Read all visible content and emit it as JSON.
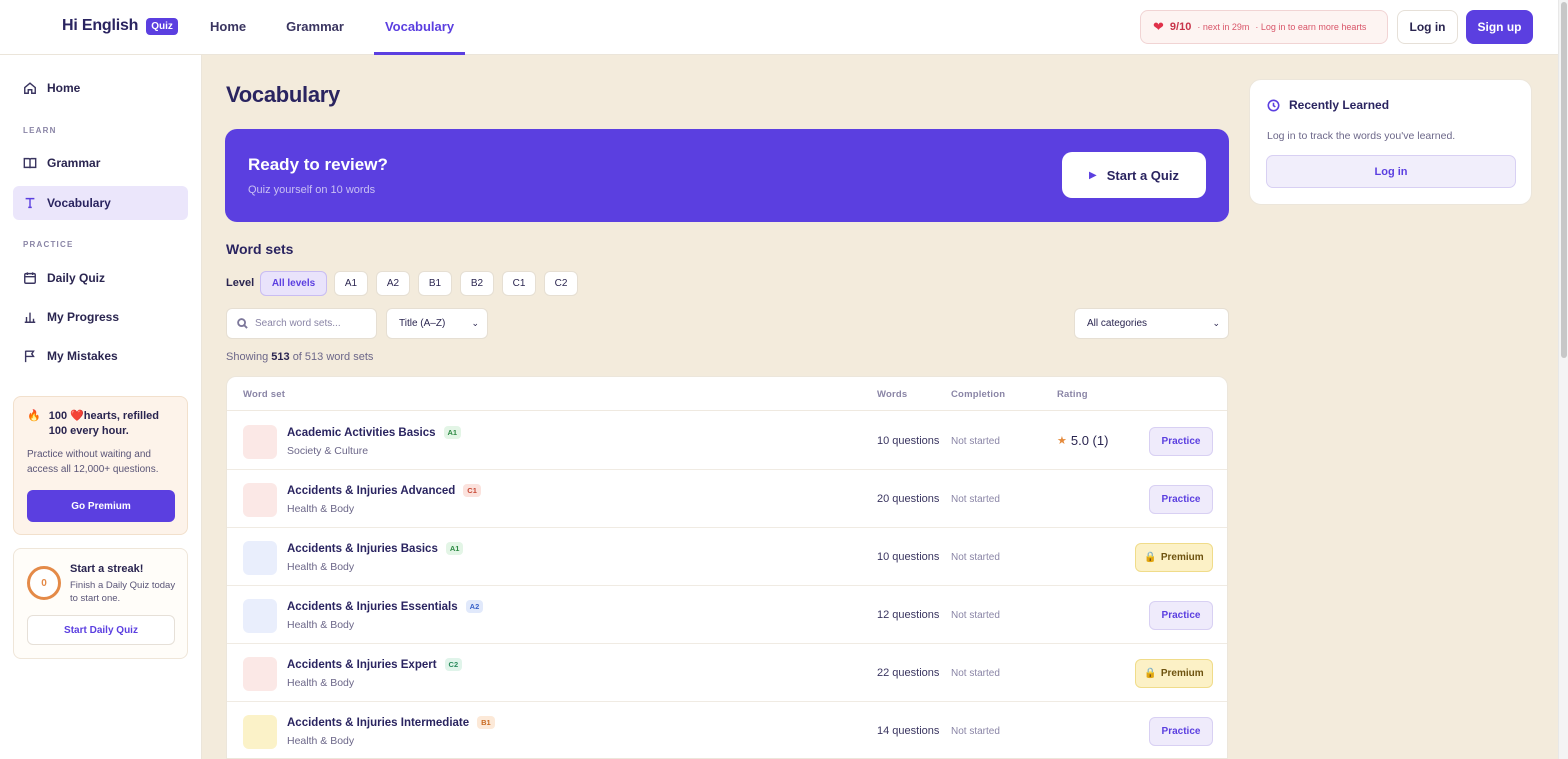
{
  "brand": {
    "name": "Hi English",
    "badge": "Quiz"
  },
  "topnav": [
    "Home",
    "Grammar",
    "Vocabulary"
  ],
  "hearts": {
    "count": "9/10",
    "next": "· next in 29m",
    "login_note": "· Log in to earn more hearts"
  },
  "auth": {
    "login": "Log in",
    "signup": "Sign up"
  },
  "sidebar": {
    "home": "Home",
    "learn_label": "LEARN",
    "grammar": "Grammar",
    "vocabulary": "Vocabulary",
    "practice_label": "PRACTICE",
    "daily_quiz": "Daily Quiz",
    "my_progress": "My Progress",
    "my_mistakes": "My Mistakes",
    "promo": {
      "title": "100 ❤️hearts, refilled 100 every hour.",
      "desc": "Practice without waiting and access all 12,000+ questions.",
      "button": "Go Premium"
    },
    "streak": {
      "count": "0",
      "title": "Start a streak!",
      "desc": "Finish a Daily Quiz today to start one.",
      "button": "Start Daily Quiz"
    }
  },
  "main": {
    "title": "Vocabulary",
    "hero": {
      "title": "Ready to review?",
      "subtitle": "Quiz yourself on 10 words",
      "button": "Start a Quiz"
    },
    "word_sets_title": "Word sets",
    "level_label": "Level",
    "levels": [
      "All levels",
      "A1",
      "A2",
      "B1",
      "B2",
      "C1",
      "C2"
    ],
    "search_placeholder": "Search word sets...",
    "sort": "Title (A–Z)",
    "category": "All categories",
    "showing": {
      "prefix": "Showing",
      "count": "513",
      "suffix": "of 513 word sets"
    },
    "table": {
      "headers": [
        "Word set",
        "Words",
        "Completion",
        "Rating"
      ],
      "rows": [
        {
          "name": "Academic Activities Basics",
          "level": "A1",
          "category": "Society & Culture",
          "words": "10 questions",
          "completion": "Not started",
          "rating": "5.0 (1)",
          "action": "Practice"
        },
        {
          "name": "Accidents & Injuries Advanced",
          "level": "C1",
          "category": "Health & Body",
          "words": "20 questions",
          "completion": "Not started",
          "rating": "",
          "action": "Practice"
        },
        {
          "name": "Accidents & Injuries Basics",
          "level": "A1",
          "category": "Health & Body",
          "words": "10 questions",
          "completion": "Not started",
          "rating": "",
          "action": "Premium"
        },
        {
          "name": "Accidents & Injuries Essentials",
          "level": "A2",
          "category": "Health & Body",
          "words": "12 questions",
          "completion": "Not started",
          "rating": "",
          "action": "Practice"
        },
        {
          "name": "Accidents & Injuries Expert",
          "level": "C2",
          "category": "Health & Body",
          "words": "22 questions",
          "completion": "Not started",
          "rating": "",
          "action": "Premium"
        },
        {
          "name": "Accidents & Injuries Intermediate",
          "level": "B1",
          "category": "Health & Body",
          "words": "14 questions",
          "completion": "Not started",
          "rating": "",
          "action": "Practice"
        }
      ]
    }
  },
  "recent": {
    "title": "Recently Learned",
    "desc": "Log in to track the words you've learned.",
    "button": "Log in"
  },
  "colors": {
    "accent": "#5b3fe0",
    "background": "#f3ebdc",
    "heart": "#e0314a",
    "premium": "#fcf1c6"
  }
}
